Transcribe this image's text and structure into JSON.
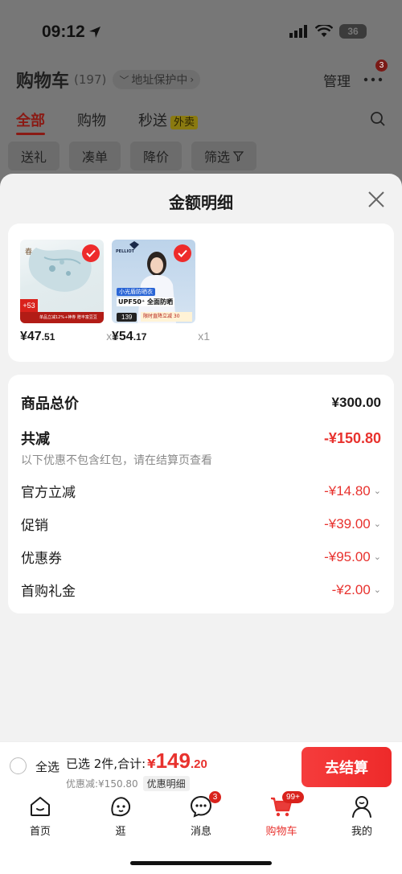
{
  "status_bar": {
    "time": "09:12",
    "battery": "36"
  },
  "background": {
    "title": "购物车",
    "count": "(197)",
    "address_protection": "地址保护中",
    "manage": "管理",
    "more_badge": "3",
    "tabs": [
      {
        "label": "全部"
      },
      {
        "label": "购物"
      },
      {
        "label": "秒送"
      }
    ],
    "waimai_tag": "外卖",
    "chips": [
      "送礼",
      "凑单",
      "降价",
      "筛选"
    ]
  },
  "sheet": {
    "title": "金额明细",
    "products": [
      {
        "price_int": "¥47",
        "price_dec": ".51",
        "qty": "x2",
        "img_tag": "+53",
        "img_banner": "单品立减12%+神券 赠丰富豆豆"
      },
      {
        "price_int": "¥54",
        "price_dec": ".17",
        "qty": "x1",
        "brand": "PELLIOT",
        "img_tag1": "小光盾防晒衣",
        "img_tag2": "UPF50⁺ 全面防晒",
        "img_price": "139",
        "img_banner": "限时直降立减 30"
      }
    ],
    "details": {
      "total_label": "商品总价",
      "total_value": "¥300.00",
      "discount_label": "共减",
      "discount_value": "-¥150.80",
      "note": "以下优惠不包含红包，请在结算页查看",
      "items": [
        {
          "label": "官方立减",
          "value": "-¥14.80"
        },
        {
          "label": "促销",
          "value": "-¥39.00"
        },
        {
          "label": "优惠券",
          "value": "-¥95.00"
        },
        {
          "label": "首购礼金",
          "value": "-¥2.00"
        }
      ]
    }
  },
  "checkout": {
    "select_all": "全选",
    "selected_text": "已选 2件,合计:",
    "yen": "¥",
    "total_int": "149",
    "total_dec": ".20",
    "discount_text": "优惠减:¥150.80",
    "detail_button": "优惠明细",
    "checkout_button": "去结算"
  },
  "tabbar": [
    {
      "label": "首页",
      "icon": "home-icon"
    },
    {
      "label": "逛",
      "icon": "browse-icon"
    },
    {
      "label": "消息",
      "icon": "message-icon",
      "badge": "3"
    },
    {
      "label": "购物车",
      "icon": "cart-icon",
      "badge": "99+"
    },
    {
      "label": "我的",
      "icon": "profile-icon"
    }
  ],
  "colors": {
    "accent": "#e8322e",
    "overlay": "#777777"
  }
}
